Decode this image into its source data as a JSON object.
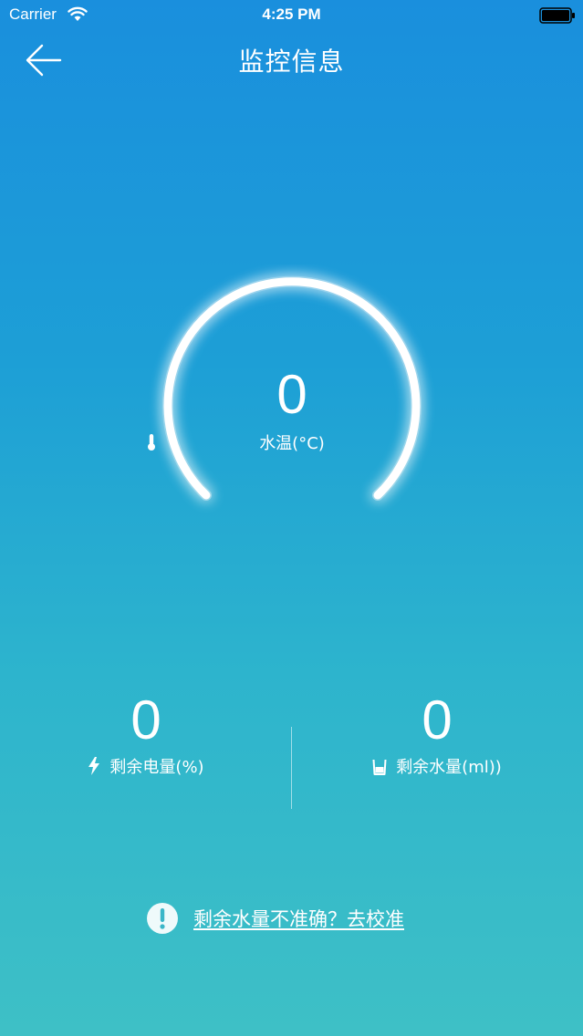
{
  "status_bar": {
    "carrier": "Carrier",
    "time": "4:25 PM"
  },
  "nav": {
    "title": "监控信息",
    "back_icon": "back-arrow-icon"
  },
  "gauge": {
    "value": "0",
    "label": "水温(°C)",
    "icon": "thermometer-icon"
  },
  "stats": {
    "battery": {
      "value": "0",
      "label": "剩余电量(%)",
      "icon": "lightning-icon"
    },
    "water": {
      "value": "0",
      "label": "剩余水量(ml))",
      "icon": "cup-icon"
    }
  },
  "calibration": {
    "icon": "alert-icon",
    "link_text": "剩余水量不准确？去校准"
  },
  "colors": {
    "gradient_top": "#1a8fdd",
    "gradient_bottom": "#3ec0c6",
    "foreground": "#ffffff"
  }
}
